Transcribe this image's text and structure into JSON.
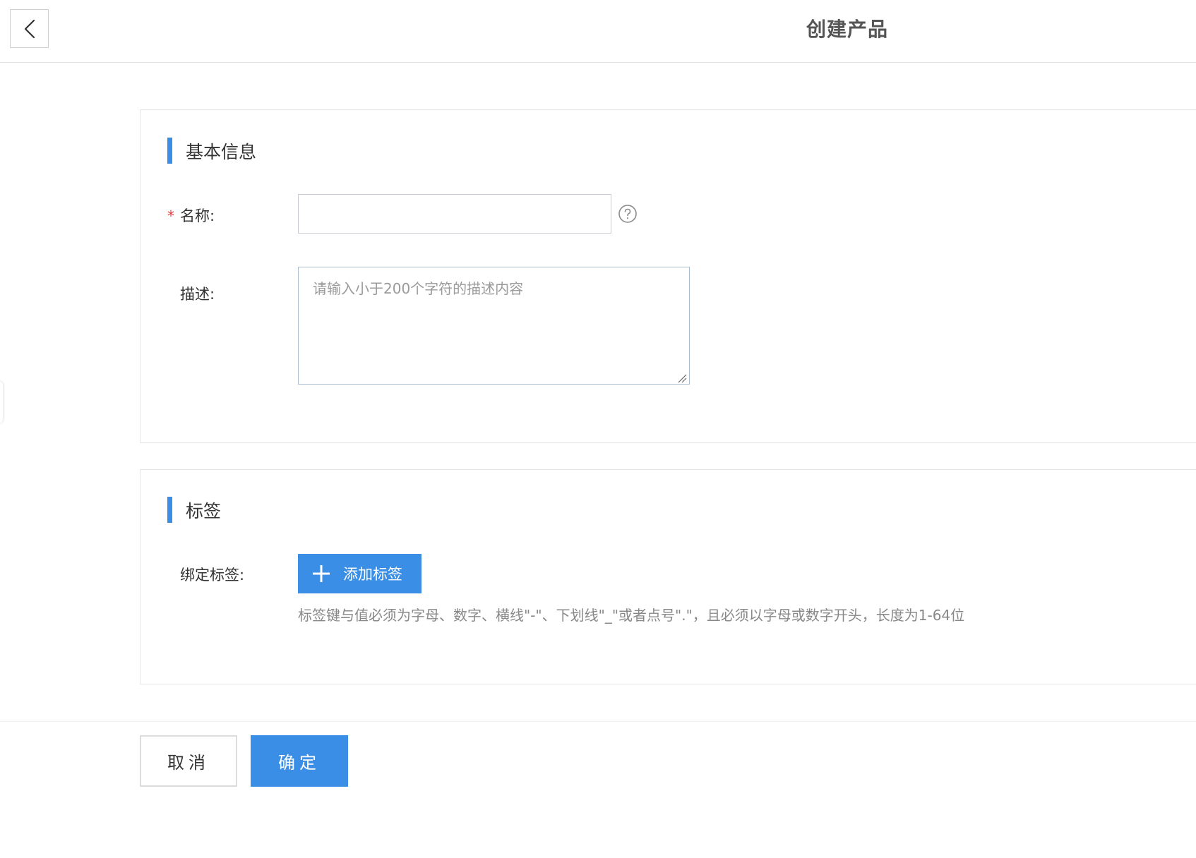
{
  "header": {
    "title": "创建产品",
    "back_icon": "chevron-left-icon"
  },
  "basic_info": {
    "section_title": "基本信息",
    "name_label": "名称:",
    "required_mark": "*",
    "name_value": "",
    "help_icon": "question-circle-icon",
    "desc_label": "描述:",
    "desc_value": "",
    "desc_placeholder": "请输入小于200个字符的描述内容"
  },
  "tags": {
    "section_title": "标签",
    "bind_label": "绑定标签:",
    "add_button_label": "添加标签",
    "add_icon": "plus-icon",
    "hint": "标签键与值必须为字母、数字、横线\"-\"、下划线\"_\"或者点号\".\"，且必须以字母或数字开头，长度为1-64位"
  },
  "footer": {
    "cancel_label": "取消",
    "confirm_label": "确定"
  },
  "colors": {
    "accent": "#3a8ee6",
    "required": "#e4393c",
    "hint_text": "#888888"
  }
}
